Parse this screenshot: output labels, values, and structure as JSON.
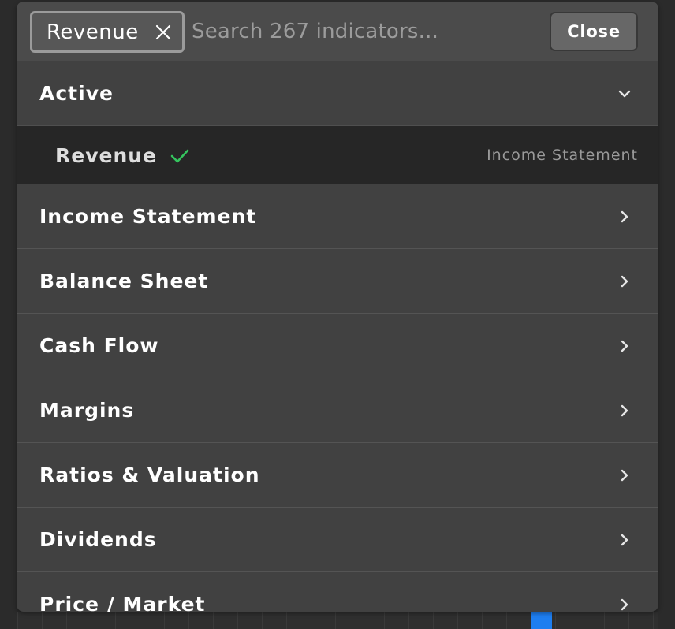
{
  "search": {
    "chip_label": "Revenue",
    "placeholder": "Search 267 indicators...",
    "value": "",
    "close_label": "Close"
  },
  "active_section": {
    "title": "Active",
    "expanded": true,
    "items": [
      {
        "name": "Revenue",
        "category": "Income Statement",
        "selected": true
      }
    ]
  },
  "categories": [
    {
      "label": "Income Statement"
    },
    {
      "label": "Balance Sheet"
    },
    {
      "label": "Cash Flow"
    },
    {
      "label": "Margins"
    },
    {
      "label": "Ratios & Valuation"
    },
    {
      "label": "Dividends"
    },
    {
      "label": "Price / Market"
    }
  ],
  "icons": {
    "chip_remove": "close-icon",
    "section_toggle": "chevron-down-icon",
    "selected_mark": "checkmark-icon",
    "category_open": "chevron-right-icon"
  },
  "colors": {
    "panel_bg": "#414141",
    "search_bar_bg": "#4b4b4b",
    "active_item_bg": "#262626",
    "check_green": "#35c45e",
    "accent_blue": "#1e7ef0"
  }
}
